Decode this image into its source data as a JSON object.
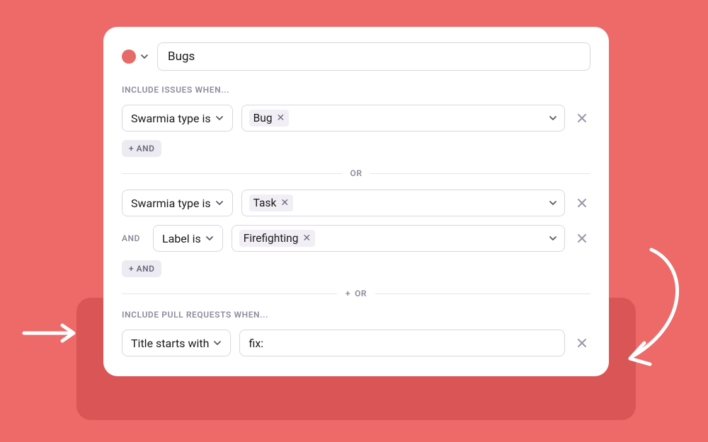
{
  "title": "Bugs",
  "color": "#e66a67",
  "sections": {
    "include_issues": {
      "label": "INCLUDE ISSUES WHEN...",
      "add_and": "+ AND",
      "or_label": "OR",
      "plus_or_label": "+ OR",
      "and_prefix": "AND",
      "group1": {
        "field": "Swarmia type is",
        "value": "Bug"
      },
      "group2": {
        "r1_field": "Swarmia type is",
        "r1_value": "Task",
        "r2_field": "Label is",
        "r2_value": "Firefighting"
      }
    },
    "include_prs": {
      "label": "INCLUDE PULL REQUESTS WHEN...",
      "field": "Title starts with",
      "value": "fix:"
    }
  }
}
